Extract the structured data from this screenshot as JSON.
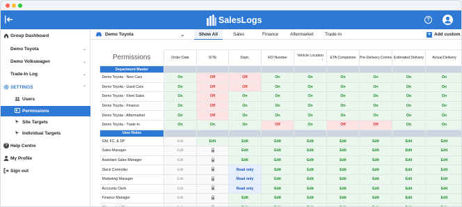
{
  "app": {
    "title": "SalesLogs"
  },
  "sidebar": {
    "items": [
      {
        "label": "Group Dashboard"
      },
      {
        "label": "Demo Toyota"
      },
      {
        "label": "Demo Volkswagen"
      },
      {
        "label": "Trade-In Log"
      },
      {
        "label": "SETTINGS"
      },
      {
        "label": "Users"
      },
      {
        "label": "Permissions"
      },
      {
        "label": "Site Targets"
      },
      {
        "label": "Individual Targets"
      },
      {
        "label": "Help Centre"
      },
      {
        "label": "My Profile"
      },
      {
        "label": "Sign out"
      }
    ]
  },
  "subbar": {
    "dealer": "Demo Toyota",
    "tabs": [
      "Show All",
      "Sales",
      "Finance",
      "Aftermarket",
      "Trade-In"
    ],
    "add_custom": "Add custom"
  },
  "table": {
    "title": "Permissions",
    "columns": [
      "Order Date",
      "SITE",
      "Dept.",
      "RO Number",
      "Vehicle Location",
      "ETA Completion",
      "Pre-Delivery Comments",
      "Estimated Delivery",
      "Actual Delivery"
    ],
    "dept_section": "Department Master",
    "dept_rows": [
      {
        "name": "Demo Toyota - New Cars",
        "cells": [
          "On",
          "Off",
          "Off",
          "On",
          "On",
          "On",
          "On",
          "On",
          "On"
        ]
      },
      {
        "name": "Demo Toyota - Used Cars",
        "cells": [
          "On",
          "Off",
          "Off",
          "On",
          "On",
          "On",
          "On",
          "On",
          "On"
        ]
      },
      {
        "name": "Demo Toyota - Fleet Sales",
        "cells": [
          "On",
          "Off",
          "On",
          "On",
          "On",
          "On",
          "On",
          "On",
          "On"
        ]
      },
      {
        "name": "Demo Toyota - Finance",
        "cells": [
          "On",
          "Off",
          "On",
          "On",
          "On",
          "On",
          "On",
          "On",
          "On"
        ]
      },
      {
        "name": "Demo Toyota - Aftermarket",
        "cells": [
          "On",
          "Off",
          "On",
          "On",
          "On",
          "On",
          "On",
          "On",
          "On"
        ]
      },
      {
        "name": "Demo Toyota - Trade-In",
        "cells": [
          "On",
          "On",
          "On",
          "Off",
          "On",
          "Off",
          "Off",
          "On",
          "On"
        ]
      }
    ],
    "roles_section": "User Roles",
    "role_rows": [
      {
        "name": "GM, FC, & DP",
        "cells": [
          "Edit",
          "Edit",
          "Edit",
          "Edit",
          "Edit",
          "Edit",
          "Edit",
          "Edit",
          "Edit"
        ]
      },
      {
        "name": "Sales Manager",
        "cells": [
          "Edit",
          "lock",
          "Edit",
          "Edit",
          "Edit",
          "Edit",
          "Edit",
          "Edit",
          "Edit"
        ]
      },
      {
        "name": "Assistant Sales Manager",
        "cells": [
          "Edit",
          "lock",
          "Edit",
          "Edit",
          "Edit",
          "Edit",
          "Edit",
          "Edit",
          "Edit"
        ]
      },
      {
        "name": "Stock Controller",
        "cells": [
          "Edit",
          "lock",
          "Read only",
          "Edit",
          "Edit",
          "Edit",
          "Edit",
          "Edit",
          "Edit"
        ]
      },
      {
        "name": "Marketing Manager",
        "cells": [
          "Edit",
          "lock",
          "Read only",
          "Edit",
          "Edit",
          "Edit",
          "Edit",
          "Edit",
          "Edit"
        ]
      },
      {
        "name": "Accounts Clerk",
        "cells": [
          "Edit",
          "lock",
          "Read only",
          "Edit",
          "Edit",
          "Edit",
          "Edit",
          "Edit",
          "Edit"
        ]
      },
      {
        "name": "Finance Manager",
        "cells": [
          "Edit",
          "lock",
          "Edit",
          "Edit",
          "Edit",
          "Edit",
          "Edit",
          "Edit",
          "Edit"
        ]
      },
      {
        "name": "Aftermarket Manager",
        "cells": [
          "Edit",
          "lock",
          "Edit",
          "Edit",
          "Edit",
          "Edit",
          "Edit",
          "Edit",
          "Edit"
        ]
      }
    ]
  },
  "colors": {
    "brand": "#2f79d6",
    "on": "#1f8a2c",
    "off": "#d32f2f",
    "readonly": "#1f4fb8"
  }
}
